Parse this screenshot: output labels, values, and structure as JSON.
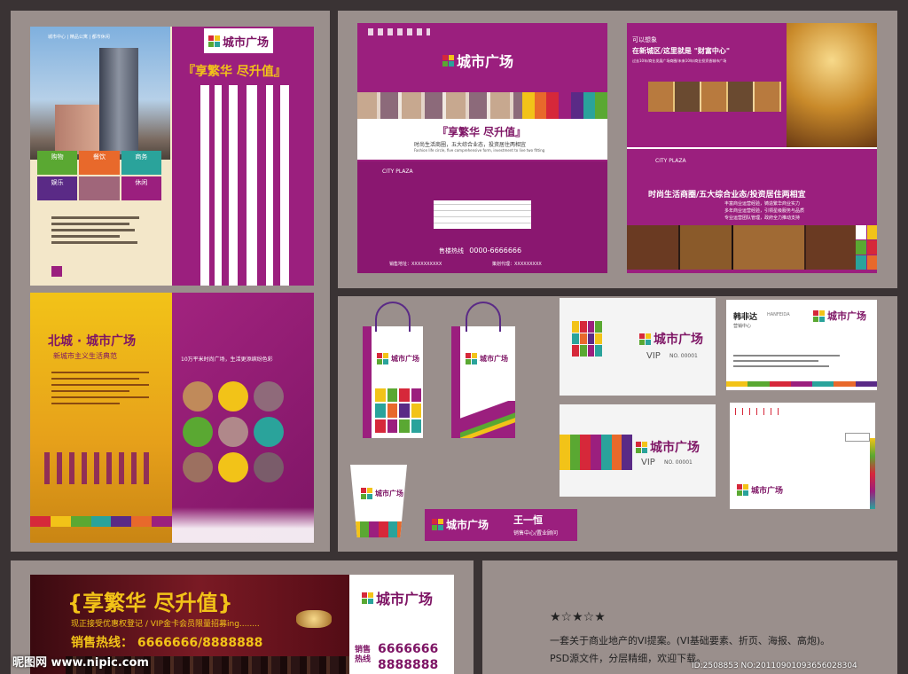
{
  "brand": {
    "name": "城市广场",
    "english": "CITY PLAZA",
    "colors": {
      "magenta": "#9b1f7e",
      "yellow": "#f2c318",
      "green": "#5aa832",
      "orange": "#e8692b",
      "red": "#d6283a",
      "purple": "#5a2a86",
      "teal": "#2aa39b"
    }
  },
  "poster1": {
    "slogan": "『享繁华 尽升值』",
    "tags": [
      "购物",
      "餐饮",
      "商务",
      "娱乐",
      "休闲"
    ],
    "top_note": "城市中心 | 精品公寓 | 都市休闲"
  },
  "folder_front": {
    "slogan": "『享繁华 尽升值』",
    "sub": "时尚生活商圈，五大综合业态，投资居住两相宜",
    "sub_en": "Fashion life circle, five comprehensive form, investment to live two fitting",
    "hotline_label": "售楼热线",
    "hotline": "0000-6666666",
    "addr_label": "销售地址：XXXXXXXXXX",
    "dev_label": "策划代理：XXXXXXXXX"
  },
  "folder_wealth": {
    "kicker": "可以想象",
    "headline": "在新城区/这里就是 \"财富中心\"",
    "lines": [
      "过去10年/商业发展广场商圈/未来10年/商业投资香城市广场"
    ],
    "tagline": "时尚生活商圈/五大综合业态/投资居住两相宜",
    "bullets": [
      "丰富商业运营经验，铸造繁华商业实力",
      "多年商业运营经验，引领星级服务与品质",
      "专业运营团队管理，政府全力推动支持"
    ]
  },
  "brochure": {
    "title": "北城 · 城市广场",
    "subtitle": "新城市主义生活典范",
    "headline": "10万平米时尚广场，生活更添缤纷色彩"
  },
  "cards": {
    "vip_label": "VIP",
    "vip_no": "NO. 00001",
    "name": "韩非达",
    "name_en": "HANFEIDA",
    "title": "营销中心",
    "badge_name": "王一恒",
    "badge_title": "销售中心/置业顾问"
  },
  "banner": {
    "slogan": "{享繁华 尽升值}",
    "line2": "现正接受优惠权登记 / VIP金卡会员限量招募ing........",
    "hotline_label": "销售热线：",
    "hotline": "6666666/8888888",
    "hotline2_label": "销售热线",
    "hotline2_a": "6666666",
    "hotline2_b": "8888888"
  },
  "desc": {
    "stars": "★☆★☆★",
    "line1": "一套关于商业地产的VI提案。(VI基础要素、折页、海报、高炮)。",
    "line2": "PSD源文件，分层精细，欢迎下载。"
  },
  "watermark": {
    "left": "昵图网 www.nipic.com",
    "right": "ID:2508853 NO:20110901093656028304"
  }
}
